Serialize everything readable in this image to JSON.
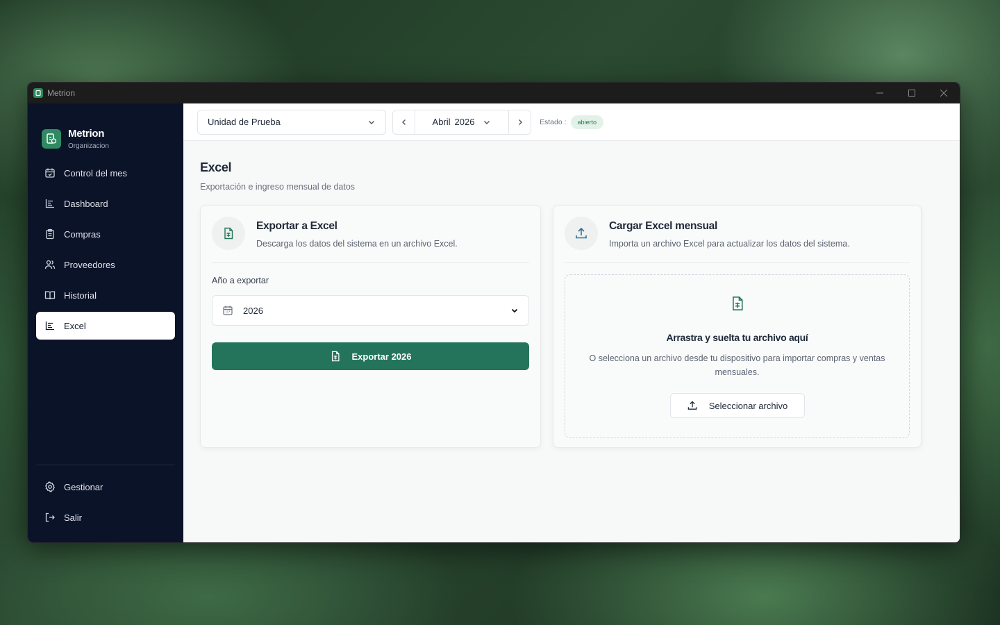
{
  "window": {
    "title": "Metrion"
  },
  "brand": {
    "name": "Metrion",
    "subtitle": "Organizacion"
  },
  "sidebar": {
    "items": [
      {
        "label": "Control del mes",
        "icon": "calendar-check-icon"
      },
      {
        "label": "Dashboard",
        "icon": "chart-icon"
      },
      {
        "label": "Compras",
        "icon": "clipboard-icon"
      },
      {
        "label": "Proveedores",
        "icon": "users-icon"
      },
      {
        "label": "Historial",
        "icon": "book-icon"
      },
      {
        "label": "Excel",
        "icon": "chart-icon",
        "active": true
      }
    ],
    "bottom": [
      {
        "label": "Gestionar",
        "icon": "gear-icon"
      },
      {
        "label": "Salir",
        "icon": "logout-icon"
      }
    ]
  },
  "topbar": {
    "unit": "Unidad de Prueba",
    "month": "Abril",
    "year": "2026",
    "estado_label": "Estado :",
    "estado_value": "abierto"
  },
  "page": {
    "title": "Excel",
    "subtitle": "Exportación e ingreso mensual de datos"
  },
  "export_card": {
    "title": "Exportar a Excel",
    "description": "Descarga los datos del sistema en un archivo Excel.",
    "field_label": "Año a exportar",
    "year_value": "2026",
    "button_label": "Exportar 2026"
  },
  "import_card": {
    "title": "Cargar Excel mensual",
    "description": "Importa un archivo Excel para actualizar los datos del sistema.",
    "drop_title": "Arrastra y suelta tu archivo aquí",
    "drop_description": "O selecciona un archivo desde tu dispositivo para importar compras y ventas mensuales.",
    "button_label": "Seleccionar archivo"
  },
  "colors": {
    "accent": "#23745a",
    "sidebar": "#0b1328",
    "badge_bg": "#e3f2e8"
  }
}
